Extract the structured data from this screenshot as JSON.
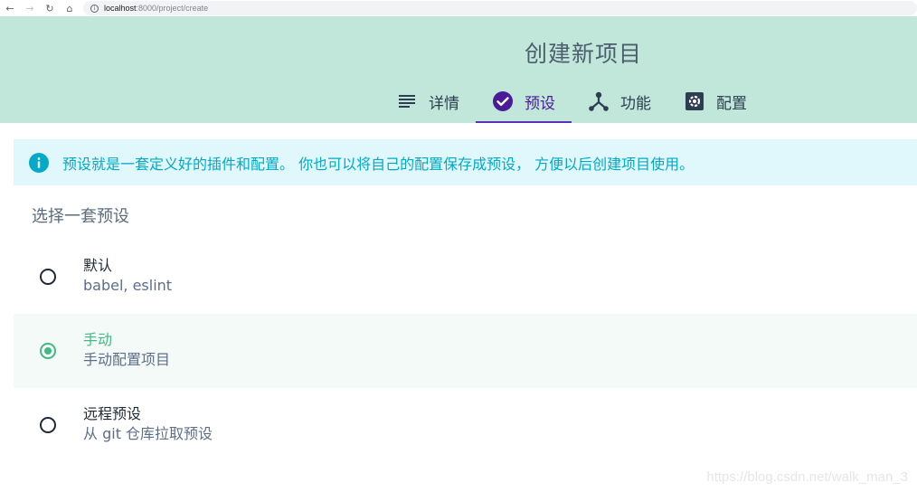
{
  "browser": {
    "back_glyph": "←",
    "forward_glyph": "→",
    "reload_glyph": "↻",
    "home_glyph": "⌂",
    "url_host": "localhost",
    "url_path": ":8000/project/create"
  },
  "header": {
    "title": "创建新项目",
    "tabs": [
      {
        "label": "详情",
        "icon": "subject-icon",
        "active": false
      },
      {
        "label": "预设",
        "icon": "check-circle-icon",
        "active": true
      },
      {
        "label": "功能",
        "icon": "device-hub-icon",
        "active": false
      },
      {
        "label": "配置",
        "icon": "settings-applications-icon",
        "active": false
      }
    ]
  },
  "banner": {
    "icon": "info-icon",
    "text": "预设就是一套定义好的插件和配置。 你也可以将自己的配置保存成预设， 方便以后创建项目使用。"
  },
  "presets": {
    "title": "选择一套预设",
    "options": [
      {
        "name": "默认",
        "description": "babel, eslint",
        "selected": false
      },
      {
        "name": "手动",
        "description": "手动配置项目",
        "selected": true
      },
      {
        "name": "远程预设",
        "description": "从 git 仓库拉取预设",
        "selected": false
      }
    ]
  },
  "watermark": "https://blog.csdn.net/walk_man_3",
  "colors": {
    "header_bg": "#c1e7da",
    "accent": "#42b983",
    "active_tab": "#4a1a99",
    "info": "#03a9c7",
    "banner_bg": "#e0f7fb"
  }
}
